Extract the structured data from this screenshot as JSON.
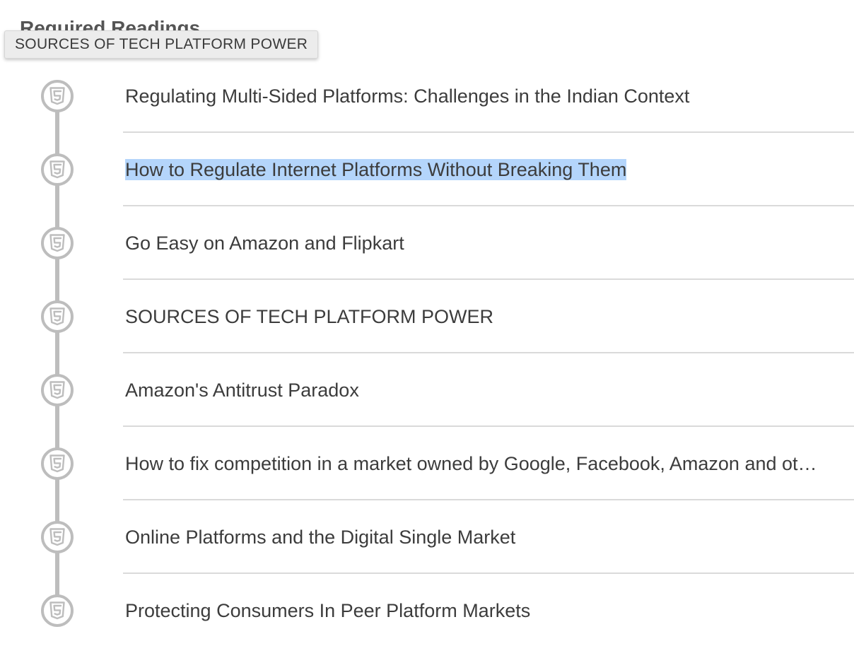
{
  "section": {
    "heading": "Required Readings"
  },
  "tooltip": {
    "text": "SOURCES OF TECH PLATFORM POWER"
  },
  "readings": [
    {
      "icon": "html5-icon",
      "title": "Regulating Multi-Sided Platforms: Challenges in the Indian Context",
      "selected": false
    },
    {
      "icon": "html5-icon",
      "title": "How to Regulate Internet Platforms Without Breaking Them",
      "selected": true
    },
    {
      "icon": "html5-icon",
      "title": "Go Easy on Amazon and Flipkart",
      "selected": false
    },
    {
      "icon": "html5-icon",
      "title": "SOURCES OF TECH PLATFORM POWER",
      "selected": false
    },
    {
      "icon": "html5-icon",
      "title": "Amazon's Antitrust Paradox",
      "selected": false
    },
    {
      "icon": "html5-icon",
      "title": "How to fix competition in a market owned by Google, Facebook, Amazon and ot…",
      "selected": false
    },
    {
      "icon": "html5-icon",
      "title": "Online Platforms and the Digital Single Market",
      "selected": false
    },
    {
      "icon": "html5-icon",
      "title": "Protecting Consumers In Peer Platform Markets",
      "selected": false
    }
  ],
  "colors": {
    "text": "#3c3c3c",
    "icon": "#bdbdbd",
    "selection_highlight": "#b4d5fb",
    "divider": "#dadada"
  }
}
